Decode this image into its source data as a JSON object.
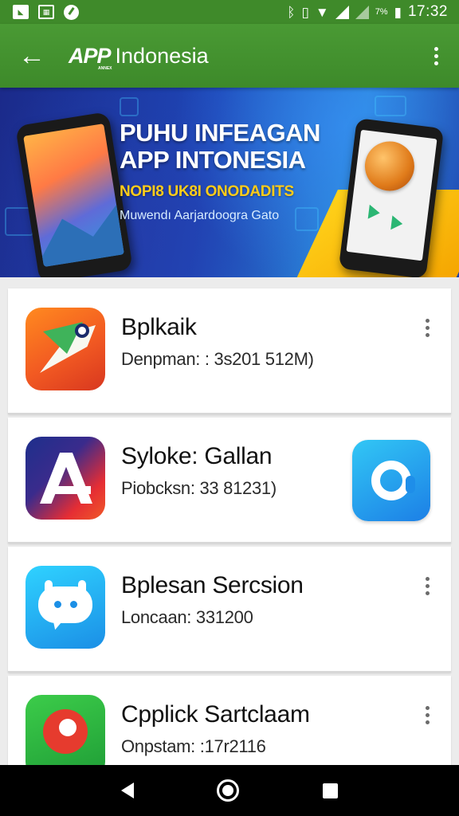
{
  "status_bar": {
    "time": "17:32",
    "battery": "7%",
    "icons": [
      "notification-icon",
      "gallery-icon",
      "compass-icon",
      "bluetooth-icon",
      "vibrate-icon",
      "wifi-icon",
      "signal-icon",
      "battery-icon"
    ]
  },
  "app_bar": {
    "back_label": "←",
    "brand": "APP",
    "title": "Indonesia"
  },
  "banner": {
    "line1": "PUHU INFEAGAN",
    "line2": "APP INTONESIA",
    "line3": "NOPI8 UK8I ONODADITS",
    "line4": "Muwendı Aarjardoogra Gato",
    "colors": {
      "background": "#1d47b8",
      "accent": "#ffcc1a"
    }
  },
  "apps": [
    {
      "name": "Bplkaik",
      "detail": "Denpman: : 3s201 512M)",
      "icon": "bird-app-icon",
      "has_menu": true
    },
    {
      "name": "Syloke: Gallan",
      "detail": "Piobcksn: 33 81231)",
      "icon": "a-app-icon",
      "has_menu": false,
      "side_icon": "circle-app-icon"
    },
    {
      "name": "Bplesan Sercsion",
      "detail": "Loncaan: 331200",
      "icon": "chat-app-icon",
      "has_menu": true
    },
    {
      "name": "Cpplick Sartclaam",
      "detail": "Onpstam: :17r2116",
      "icon": "green-bird-app-icon",
      "has_menu": true
    }
  ],
  "nav_bar": {
    "icons": [
      "back-triangle-icon",
      "home-circle-icon",
      "recent-square-icon"
    ]
  },
  "colors": {
    "primary": "#3f8a2a",
    "card": "#ffffff",
    "background": "#ececec"
  }
}
